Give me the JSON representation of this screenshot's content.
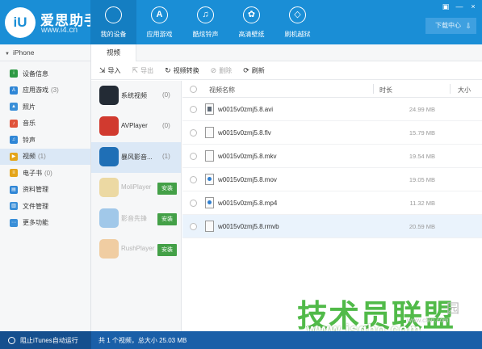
{
  "brand": {
    "logo_text": "iU",
    "name": "爱思助手",
    "url": "www.i4.cn"
  },
  "nav": [
    {
      "label": "我的设备",
      "icon": "apple-icon",
      "glyph": ""
    },
    {
      "label": "应用游戏",
      "icon": "app-store-icon",
      "glyph": "A"
    },
    {
      "label": "酷炫铃声",
      "icon": "music-note-icon",
      "glyph": "♫"
    },
    {
      "label": "高清壁纸",
      "icon": "flower-icon",
      "glyph": "✿"
    },
    {
      "label": "刷机越狱",
      "icon": "dropbox-icon",
      "glyph": "◇"
    }
  ],
  "window_controls": [
    "▣",
    "—",
    "×"
  ],
  "download_center": {
    "label": "下载中心",
    "icon_glyph": "⇩"
  },
  "device": {
    "name": "iPhone"
  },
  "sidebar": [
    {
      "label": "设备信息",
      "count": "",
      "color": "#2e9a44",
      "glyph": "i"
    },
    {
      "label": "应用游戏",
      "count": "(3)",
      "color": "#2f86d6",
      "glyph": "A"
    },
    {
      "label": "照片",
      "count": "",
      "color": "#3a8fd8",
      "glyph": "▲"
    },
    {
      "label": "音乐",
      "count": "",
      "color": "#e0533a",
      "glyph": "♪"
    },
    {
      "label": "铃声",
      "count": "",
      "color": "#2f86d6",
      "glyph": "♫"
    },
    {
      "label": "视频",
      "count": "(1)",
      "color": "#e4a51a",
      "glyph": "▶"
    },
    {
      "label": "电子书",
      "count": "(0)",
      "color": "#e4a51a",
      "glyph": "≡"
    },
    {
      "label": "资料管理",
      "count": "",
      "color": "#2f86d6",
      "glyph": "▤"
    },
    {
      "label": "文件管理",
      "count": "",
      "color": "#3a8fd8",
      "glyph": "▥"
    },
    {
      "label": "更多功能",
      "count": "",
      "color": "#3a8fd8",
      "glyph": "⋯"
    }
  ],
  "tab": {
    "label": "视频"
  },
  "toolbar": [
    {
      "label": "导入",
      "glyph": "⇲",
      "disabled": false
    },
    {
      "label": "导出",
      "glyph": "⇱",
      "disabled": true
    },
    {
      "label": "视频转换",
      "glyph": "↻",
      "disabled": false
    },
    {
      "label": "删除",
      "glyph": "⊘",
      "disabled": true
    },
    {
      "label": "刷新",
      "glyph": "⟳",
      "disabled": false
    }
  ],
  "players": [
    {
      "name": "系统视频",
      "count": "(0)",
      "install": false,
      "dim": false,
      "color": "#232b35"
    },
    {
      "name": "AVPlayer",
      "count": "(0)",
      "install": false,
      "dim": false,
      "color": "#d13a2f"
    },
    {
      "name": "暴风影音...",
      "count": "(1)",
      "install": false,
      "dim": false,
      "color": "#1f6fb6"
    },
    {
      "name": "MoliPlayer",
      "count": "",
      "install": true,
      "dim": true,
      "color": "#e0b43c"
    },
    {
      "name": "影音先锋",
      "count": "",
      "install": true,
      "dim": true,
      "color": "#3a8fd8"
    },
    {
      "name": "RushPlayer",
      "count": "",
      "install": true,
      "dim": true,
      "color": "#e89a3a"
    }
  ],
  "install_label": "安装",
  "table": {
    "headers": {
      "name": "视频名称",
      "duration": "时长",
      "size": "大小"
    },
    "rows": [
      {
        "name": "w0015v0zmj5.8.avi",
        "duration": "",
        "size": "24.99 MB",
        "icon": "type-dark"
      },
      {
        "name": "w0015v0zmj5.8.flv",
        "duration": "",
        "size": "15.79 MB",
        "icon": "plain"
      },
      {
        "name": "w0015v0zmj5.8.mkv",
        "duration": "",
        "size": "19.54 MB",
        "icon": "plain"
      },
      {
        "name": "w0015v0zmj5.8.mov",
        "duration": "",
        "size": "19.05 MB",
        "icon": "type-blue"
      },
      {
        "name": "w0015v0zmj5.8.mp4",
        "duration": "",
        "size": "11.32 MB",
        "icon": "type-blue"
      },
      {
        "name": "w0015v0zmj5.8.rmvb",
        "duration": "",
        "size": "20.59 MB",
        "icon": "plain"
      }
    ]
  },
  "footer": {
    "itunes_toggle": "阻止iTunes自动运行",
    "status": "共 1 个视频，总大小 25.03 MB"
  },
  "watermark": {
    "main": "技术员联盟",
    "suffix": "园",
    "url": "www.jsgho.com",
    "faint": "www.cfan.com"
  }
}
